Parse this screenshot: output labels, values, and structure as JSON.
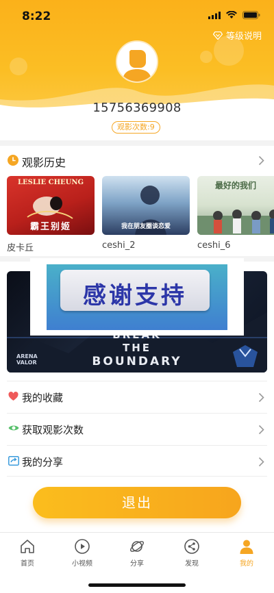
{
  "status_bar": {
    "time": "8:22"
  },
  "header": {
    "level_link": "等级说明",
    "phone": "15756369908",
    "views_badge": "观影次数:9"
  },
  "history": {
    "title": "观影历史",
    "items": [
      {
        "title": "皮卡丘",
        "poster_top": "LESLIE CHEUNG",
        "poster_bottom": "霸王别姬"
      },
      {
        "title": "ceshi_2",
        "poster_bottom": "我在朋友圈谈恋爱"
      },
      {
        "title": "ceshi_6",
        "poster_top": "最好的我们"
      }
    ]
  },
  "banner": {
    "line1": "BREAK",
    "line2": "THE",
    "line3": "BOUNDARY",
    "logo_text": "ARENA\nVALOR",
    "overlay_text": "感谢支持"
  },
  "menu": [
    {
      "label": "我的收藏",
      "icon": "heart-icon"
    },
    {
      "label": "获取观影次数",
      "icon": "eye-icon"
    },
    {
      "label": "我的分享",
      "icon": "share-icon"
    }
  ],
  "logout_label": "退出",
  "tabs": [
    {
      "label": "首页",
      "icon": "home-icon"
    },
    {
      "label": "小视频",
      "icon": "play-icon"
    },
    {
      "label": "分享",
      "icon": "planet-icon"
    },
    {
      "label": "发现",
      "icon": "share-nodes-icon"
    },
    {
      "label": "我的",
      "icon": "person-icon",
      "active": true
    }
  ],
  "colors": {
    "accent": "#F5A623",
    "header": "#FBB11A",
    "overlay_text": "#2C36A8"
  }
}
